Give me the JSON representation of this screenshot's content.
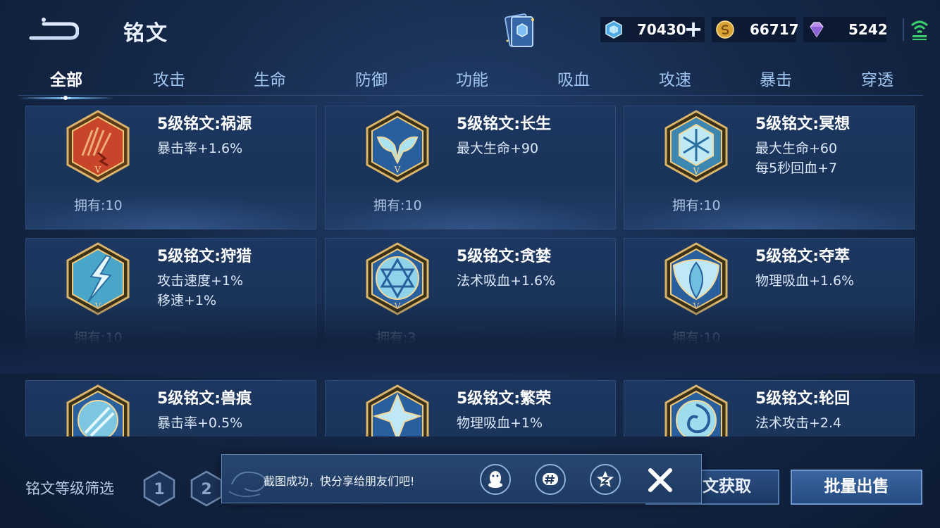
{
  "header": {
    "title": "铭文",
    "currencies": {
      "coupon": "70430",
      "gold": "66717",
      "diamond": "5242"
    }
  },
  "tabs": [
    "全部",
    "攻击",
    "生命",
    "防御",
    "功能",
    "吸血",
    "攻速",
    "暴击",
    "穿透"
  ],
  "active_tab": "全部",
  "runes": [
    {
      "name": "5级铭文:祸源",
      "stats": [
        "暴击率+1.6%"
      ],
      "owned": "拥有:10",
      "color": "#c8452b"
    },
    {
      "name": "5级铭文:长生",
      "stats": [
        "最大生命+90"
      ],
      "owned": "拥有:10",
      "color": "#2a5f9e"
    },
    {
      "name": "5级铭文:冥想",
      "stats": [
        "最大生命+60",
        "每5秒回血+7"
      ],
      "owned": "拥有:10",
      "color": "#2a5f9e"
    },
    {
      "name": "5级铭文:狩猎",
      "stats": [
        "攻击速度+1%",
        "移速+1%"
      ],
      "owned": "拥有:10",
      "color": "#2a5f9e"
    },
    {
      "name": "5级铭文:贪婪",
      "stats": [
        "法术吸血+1.6%"
      ],
      "owned": "拥有:3",
      "color": "#2a5f9e"
    },
    {
      "name": "5级铭文:夺萃",
      "stats": [
        "物理吸血+1.6%"
      ],
      "owned": "拥有:10",
      "color": "#2a5f9e"
    },
    {
      "name": "5级铭文:兽痕",
      "stats": [
        "暴击率+0.5%"
      ],
      "owned": "",
      "color": "#2a5f9e"
    },
    {
      "name": "5级铭文:繁荣",
      "stats": [
        "物理吸血+1%"
      ],
      "owned": "",
      "color": "#2a5f9e"
    },
    {
      "name": "5级铭文:轮回",
      "stats": [
        "法术攻击+2.4"
      ],
      "owned": "",
      "color": "#2a5f9e"
    }
  ],
  "bottom": {
    "filter_label": "铭文等级筛选",
    "level_filters": [
      "1",
      "2"
    ],
    "obtain_label": "文获取",
    "sell_label": "批量出售"
  },
  "toast": {
    "message": "截图成功，快分享给朋友们吧!"
  },
  "colors": {
    "accent": "#7ec4ff",
    "gold_frame": "#c9a45c",
    "background": "#16294a"
  },
  "icons": {
    "back": "back-arrow-icon",
    "book": "rune-book-icon",
    "coupon": "coupon-icon",
    "gold": "gold-coin-icon",
    "diamond": "diamond-icon",
    "wifi": "wifi-signal-icon",
    "qq": "qq-penguin-icon",
    "wechat_moments": "hashtag-icon",
    "qzone": "qzone-star-icon",
    "close": "close-icon"
  }
}
